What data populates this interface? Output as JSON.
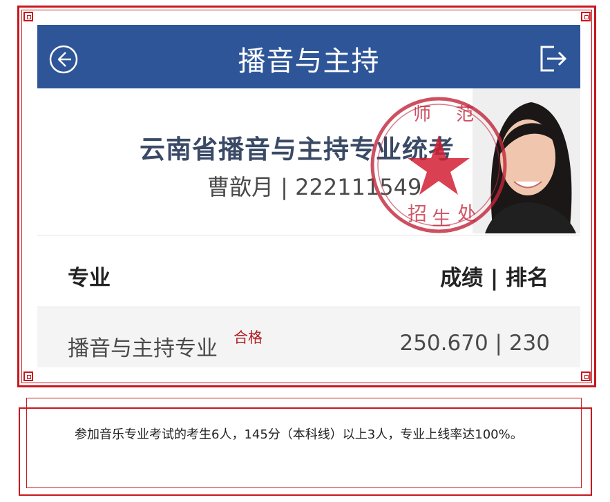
{
  "app": {
    "title": "播音与主持",
    "back_icon": "back-arrow-circle-icon",
    "exit_icon": "logout-icon"
  },
  "header": {
    "exam_title": "云南省播音与主持专业统考",
    "candidate_line": "曹歆月 | 222111549",
    "seal_text": "师范 大学 招生处"
  },
  "table": {
    "col_major": "专业",
    "col_score": "成绩 | 排名",
    "rows": [
      {
        "major": "播音与主持专业",
        "tag": "合格",
        "score_rank": "250.670 | 230"
      }
    ]
  },
  "note": {
    "text": "参加音乐专业考试的考生6人，145分（本科线）以上3人，专业上线率达100%。"
  },
  "colors": {
    "frame_red": "#c8161d",
    "topbar_blue": "#2e5597",
    "pass_red": "#b01d22"
  }
}
